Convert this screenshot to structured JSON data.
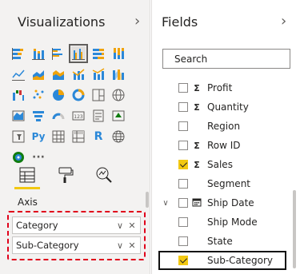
{
  "viz_pane": {
    "title": "Visualizations",
    "expand_icon": "chevron-right-icon",
    "visual_icons": [
      [
        "stacked-bar-icon",
        "stacked-column-icon",
        "clustered-bar-icon",
        "clustered-column-icon",
        "100pct-stacked-bar-icon",
        "100pct-stacked-column-icon"
      ],
      [
        "line-chart-icon",
        "area-chart-icon",
        "stacked-area-icon",
        "line-clustered-column-icon",
        "line-stacked-column-icon",
        "ribbon-chart-icon"
      ],
      [
        "waterfall-icon",
        "scatter-icon",
        "pie-chart-icon",
        "donut-chart-icon",
        "treemap-icon",
        "map-icon"
      ],
      [
        "filled-map-icon",
        "funnel-icon",
        "gauge-icon",
        "card-icon",
        "multirow-card-icon",
        "kpi-icon"
      ],
      [
        "slicer-icon",
        "python-visual-icon",
        "table-icon",
        "matrix-icon",
        "r-visual-icon",
        "globe-icon"
      ]
    ],
    "selected_visual": "clustered-column-icon",
    "python_label": "Py",
    "r_label": "R",
    "more_label": "···",
    "subtabs": [
      "fields-tab-icon",
      "format-paint-icon",
      "analytics-icon"
    ],
    "section_label": "Axis",
    "axis_wells": [
      {
        "label": "Category",
        "dropdown_icon": "chevron-down-icon",
        "remove_icon": "close-icon"
      },
      {
        "label": "Sub-Category",
        "dropdown_icon": "chevron-down-icon",
        "remove_icon": "close-icon"
      }
    ]
  },
  "fields_pane": {
    "title": "Fields",
    "expand_icon": "chevron-right-icon",
    "search": {
      "placeholder": "Search",
      "icon": "search-icon"
    },
    "fields": [
      {
        "name": "Profit",
        "type": "Σ",
        "checked": false,
        "expander": ""
      },
      {
        "name": "Quantity",
        "type": "Σ",
        "checked": false,
        "expander": ""
      },
      {
        "name": "Region",
        "type": "",
        "checked": false,
        "expander": ""
      },
      {
        "name": "Row ID",
        "type": "Σ",
        "checked": false,
        "expander": ""
      },
      {
        "name": "Sales",
        "type": "Σ",
        "checked": true,
        "expander": ""
      },
      {
        "name": "Segment",
        "type": "",
        "checked": false,
        "expander": ""
      },
      {
        "name": "Ship Date",
        "type": "calendar-icon",
        "checked": false,
        "expander": "∨"
      },
      {
        "name": "Ship Mode",
        "type": "",
        "checked": false,
        "expander": ""
      },
      {
        "name": "State",
        "type": "",
        "checked": false,
        "expander": ""
      },
      {
        "name": "Sub-Category",
        "type": "",
        "checked": true,
        "expander": ""
      }
    ],
    "highlighted_field": "Sub-Category"
  },
  "colors": {
    "accent": "#f2c811",
    "highlight_dash": "#e0001b",
    "pane_bg": "#f3f2f1"
  }
}
